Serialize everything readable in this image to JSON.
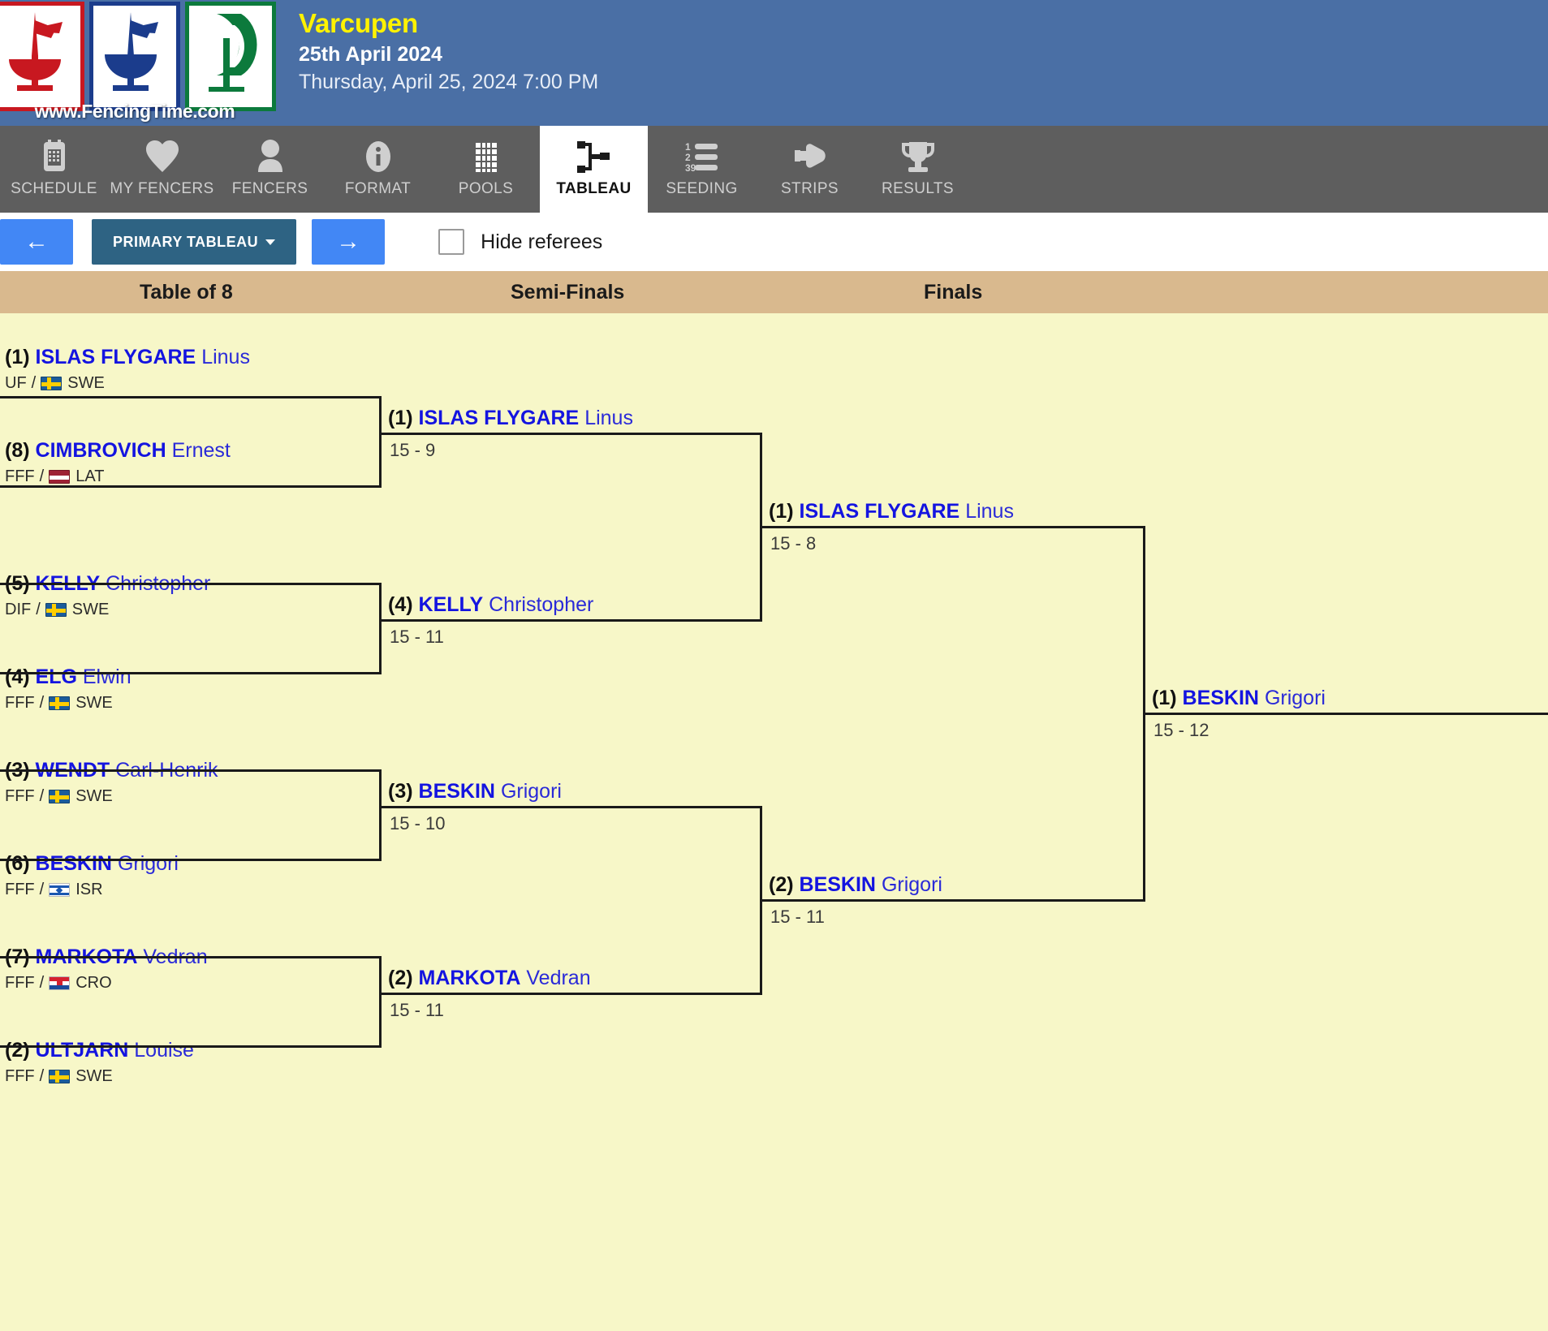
{
  "header": {
    "logo_site": "www.FencingTime.com",
    "event_title": "Varcupen",
    "event_date": "25th April 2024",
    "event_datetime": "Thursday, April 25, 2024 7:00 PM"
  },
  "tabs": [
    {
      "label": "SCHEDULE",
      "icon": "calendar-icon",
      "active": false
    },
    {
      "label": "MY FENCERS",
      "icon": "heart-icon",
      "active": false
    },
    {
      "label": "FENCERS",
      "icon": "person-icon",
      "active": false
    },
    {
      "label": "FORMAT",
      "icon": "info-icon",
      "active": false
    },
    {
      "label": "POOLS",
      "icon": "grid-icon",
      "active": false
    },
    {
      "label": "TABLEAU",
      "icon": "bracket-icon",
      "active": true
    },
    {
      "label": "SEEDING",
      "icon": "numlist-icon",
      "active": false
    },
    {
      "label": "STRIPS",
      "icon": "pointer-icon",
      "active": false
    },
    {
      "label": "RESULTS",
      "icon": "trophy-icon",
      "active": false
    }
  ],
  "toolbar": {
    "prev_label": "←",
    "next_label": "→",
    "tableau_select_label": "PRIMARY TABLEAU",
    "hide_referees_label": "Hide referees",
    "hide_referees_checked": false
  },
  "round_headers": [
    {
      "label": "Table of 8"
    },
    {
      "label": "Semi-Finals"
    },
    {
      "label": "Finals"
    }
  ],
  "chart_data": {
    "type": "table",
    "title": "Varcupen Primary Tableau — Table of 8",
    "rounds": [
      "Table of 8",
      "Semi-Finals",
      "Finals"
    ],
    "table_of_8": [
      {
        "seed": "(1)",
        "last": "ISLAS FLYGARE",
        "first": "Linus",
        "club": "UF",
        "flag": "swe",
        "country": "SWE"
      },
      {
        "seed": "(8)",
        "last": "CIMBROVICH",
        "first": "Ernest",
        "club": "FFF",
        "flag": "lat",
        "country": "LAT"
      },
      {
        "seed": "(5)",
        "last": "KELLY",
        "first": "Christopher",
        "club": "DIF",
        "flag": "swe",
        "country": "SWE"
      },
      {
        "seed": "(4)",
        "last": "ELG",
        "first": "Elwin",
        "club": "FFF",
        "flag": "swe",
        "country": "SWE"
      },
      {
        "seed": "(3)",
        "last": "WENDT",
        "first": "Carl-Henrik",
        "club": "FFF",
        "flag": "swe",
        "country": "SWE"
      },
      {
        "seed": "(6)",
        "last": "BESKIN",
        "first": "Grigori",
        "club": "FFF",
        "flag": "isr",
        "country": "ISR"
      },
      {
        "seed": "(7)",
        "last": "MARKOTA",
        "first": "Vedran",
        "club": "FFF",
        "flag": "cro",
        "country": "CRO"
      },
      {
        "seed": "(2)",
        "last": "ULTJARN",
        "first": "Louise",
        "club": "FFF",
        "flag": "swe",
        "country": "SWE"
      }
    ],
    "semi_finals": [
      {
        "seed": "(1)",
        "last": "ISLAS FLYGARE",
        "first": "Linus",
        "score": "15 - 9"
      },
      {
        "seed": "(4)",
        "last": "KELLY",
        "first": "Christopher",
        "score": "15 - 11"
      },
      {
        "seed": "(3)",
        "last": "BESKIN",
        "first": "Grigori",
        "score": "15 - 10"
      },
      {
        "seed": "(2)",
        "last": "MARKOTA",
        "first": "Vedran",
        "score": "15 - 11"
      }
    ],
    "finals": [
      {
        "seed": "(1)",
        "last": "ISLAS FLYGARE",
        "first": "Linus",
        "score": "15 - 8"
      },
      {
        "seed": "(2)",
        "last": "BESKIN",
        "first": "Grigori",
        "score": "15 - 11"
      }
    ],
    "champion": {
      "seed": "(1)",
      "last": "BESKIN",
      "first": "Grigori",
      "score": "15 - 12"
    }
  }
}
